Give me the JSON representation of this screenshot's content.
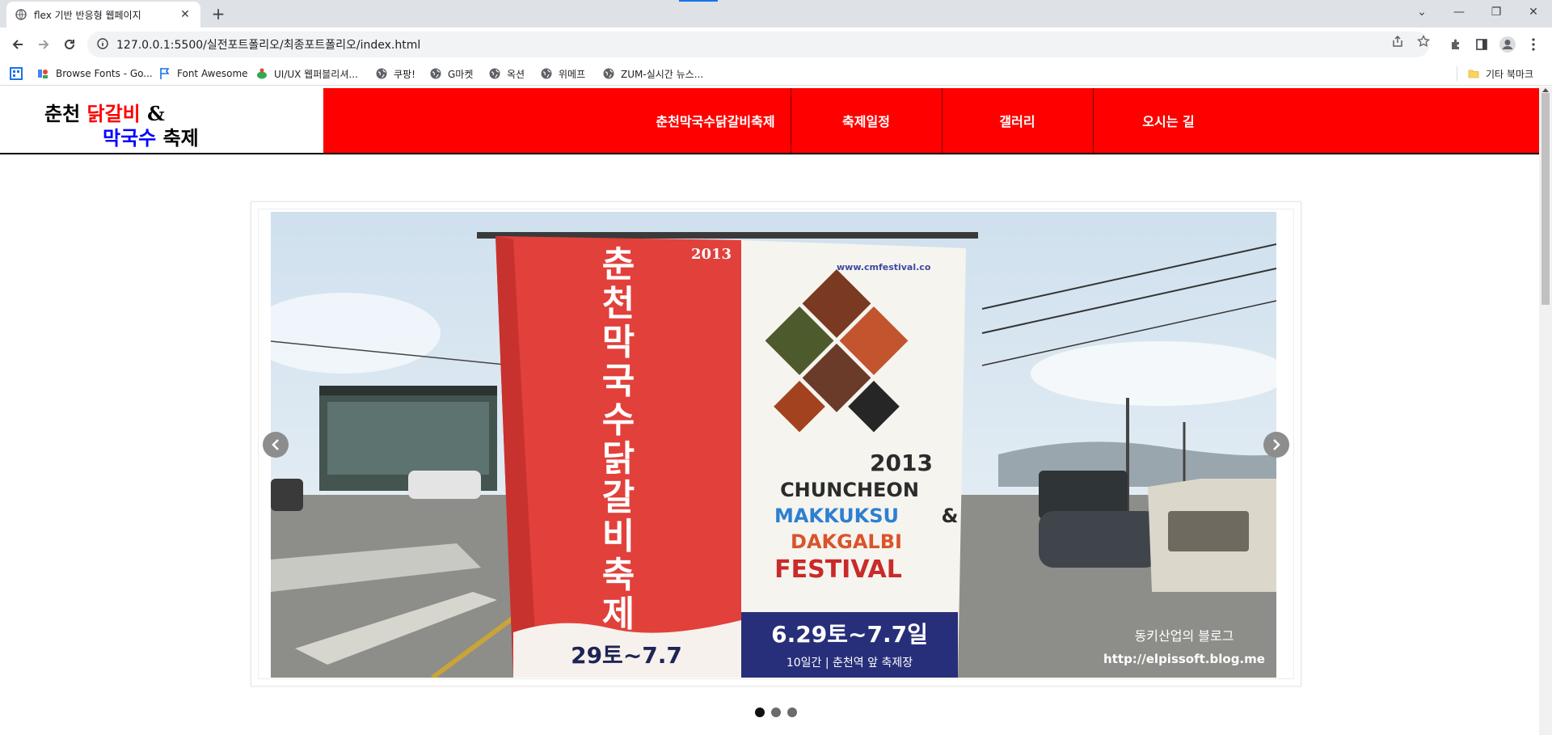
{
  "browser": {
    "tab_title": "flex 기반 반응형 웹페이지",
    "url": "127.0.0.1:5500/실전포트폴리오/최종포트폴리오/index.html",
    "bookmarks": [
      {
        "label": "Browse Fonts - Go..."
      },
      {
        "label": "Font Awesome"
      },
      {
        "label": "UI/UX 웹퍼블리셔..."
      },
      {
        "label": "쿠팡!"
      },
      {
        "label": "G마켓"
      },
      {
        "label": "옥션"
      },
      {
        "label": "위메프"
      },
      {
        "label": "ZUM-실시간 뉴스..."
      }
    ],
    "other_bookmarks": "기타 북마크"
  },
  "site": {
    "logo": {
      "line1_a": "춘천 ",
      "line1_b": "닭갈비",
      "line1_c": " &",
      "line2_a": "막국수",
      "line2_b": " 축제"
    },
    "nav": [
      {
        "label": "춘천막국수닭갈비축제"
      },
      {
        "label": "축제일정"
      },
      {
        "label": "갤러리"
      },
      {
        "label": "오시는 길"
      }
    ],
    "slider": {
      "banner_left": {
        "year": "2013",
        "title_chars": [
          "춘",
          "천",
          "막",
          "국",
          "수",
          "닭",
          "갈",
          "비",
          "축",
          "제"
        ],
        "date": "29토~7.7"
      },
      "banner_right": {
        "site": "www.cmfestival.co",
        "year": "2013",
        "line1": "CHUNCHEON",
        "line2": "MAKKUKSU",
        "amp": "&",
        "line3": "DAKGALBI",
        "line4": "FESTIVAL",
        "date": "6.29토~7.7일",
        "venue": "10일간 | 춘천역 앞 축제장"
      },
      "watermark": "http://elpissoft.blog.me",
      "watermark_sig": "동키산업의 블로그",
      "slide_count": 3,
      "active_slide": 1
    },
    "colors": {
      "nav_bg": "#ff0000",
      "logo_red": "#ff0000",
      "logo_blue": "#0000ff"
    }
  }
}
